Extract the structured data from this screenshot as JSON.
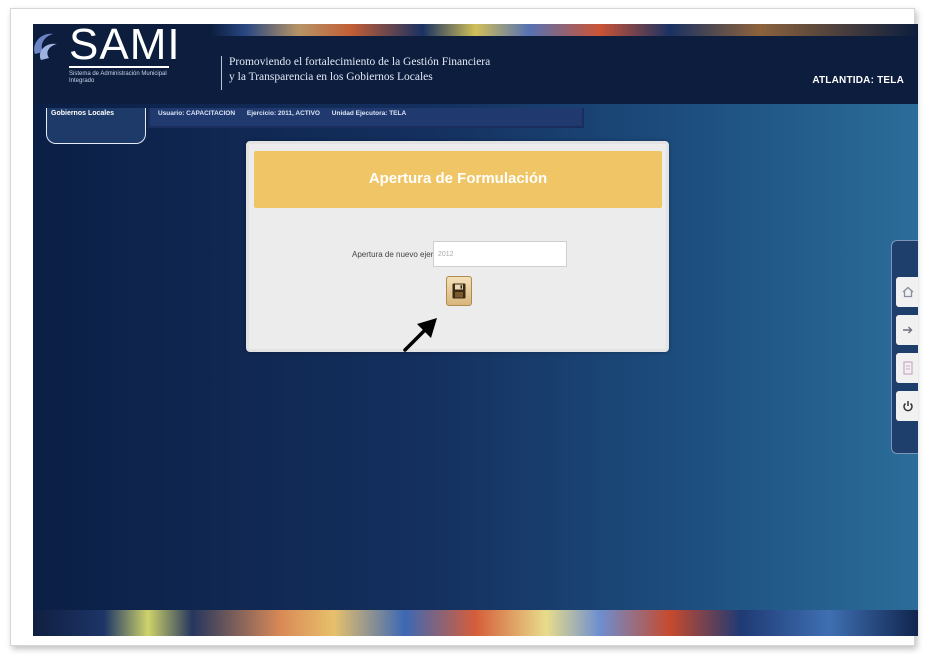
{
  "header": {
    "logo_text": "SAMI",
    "logo_subtitle": "Sistema de Administración Municipal Integrado",
    "tagline_line1": "Promoviendo el fortalecimiento de la Gestión Financiera",
    "tagline_line2": "y la Transparencia en los Gobiernos Locales",
    "location": "ATLANTIDA: TELA"
  },
  "tabs": {
    "active_label": "Gobiernos Locales"
  },
  "info_bar": {
    "user": "Usuario: CAPACITACION",
    "exercise": "Ejercicio: 2011, ACTIVO",
    "unit": "Unidad Ejecutora: TELA"
  },
  "form": {
    "title": "Apertura de Formulación",
    "field_label": "Apertura de nuevo ejercicio:",
    "field_value": "2012"
  },
  "icons": {
    "save": "floppy-disk-icon",
    "pointer": "arrow-pointer-icon",
    "dock": [
      "home-icon",
      "exit-icon",
      "report-icon",
      "power-icon"
    ]
  },
  "colors": {
    "header_bg": "#0c1d3d",
    "panel_header": "#efc565",
    "panel_bg": "#ececec"
  }
}
